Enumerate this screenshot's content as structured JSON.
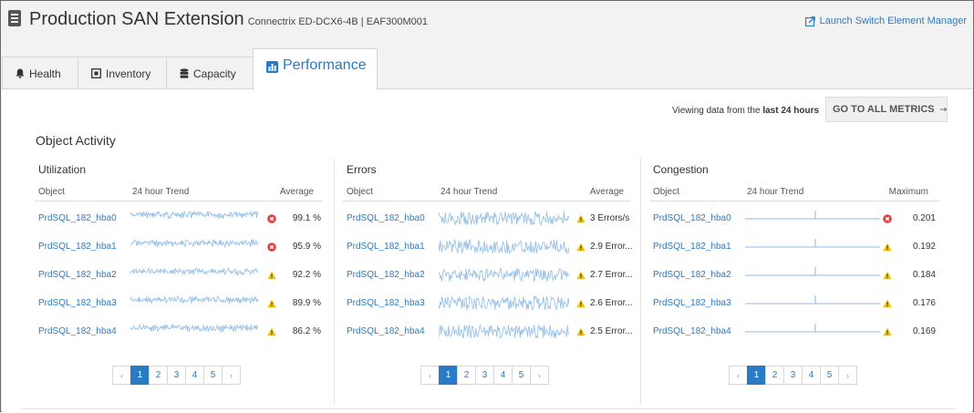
{
  "header": {
    "title": "Production SAN Extension",
    "subtitle": "Connectrix ED-DCX6-4B | EAF300M001",
    "launch_label": "Launch Switch Element Manager"
  },
  "tabs": [
    {
      "label": "Health",
      "icon": "bell-icon"
    },
    {
      "label": "Inventory",
      "icon": "inventory-icon"
    },
    {
      "label": "Capacity",
      "icon": "database-icon"
    },
    {
      "label": "Performance",
      "icon": "bar-chart-icon",
      "active": true
    }
  ],
  "toolbar": {
    "viewing_prefix": "Viewing data from the",
    "viewing_range": "last 24 hours",
    "metrics_button": "GO TO ALL METRICS"
  },
  "section_title": "Object Activity",
  "colors": {
    "accent": "#2a7bc4",
    "sparkline": "#8fbde6",
    "error": "#e0403a",
    "warning": "#f5c400"
  },
  "cards": [
    {
      "title": "Utilization",
      "columns": [
        "Object",
        "24 hour Trend",
        "Average"
      ],
      "trend_style": "dense-high",
      "rows": [
        {
          "object": "PrdSQL_182_hba0",
          "status": "error",
          "value": "99.1 %"
        },
        {
          "object": "PrdSQL_182_hba1",
          "status": "error",
          "value": "95.9 %"
        },
        {
          "object": "PrdSQL_182_hba2",
          "status": "warning",
          "value": "92.2 %"
        },
        {
          "object": "PrdSQL_182_hba3",
          "status": "warning",
          "value": "89.9 %"
        },
        {
          "object": "PrdSQL_182_hba4",
          "status": "warning",
          "value": "86.2 %"
        }
      ],
      "pagination": {
        "pages": [
          "1",
          "2",
          "3",
          "4",
          "5"
        ],
        "current": "1",
        "prev": "‹",
        "next": "›"
      }
    },
    {
      "title": "Errors",
      "columns": [
        "Object",
        "24 hour Trend",
        "Average"
      ],
      "trend_style": "noisy",
      "rows": [
        {
          "object": "PrdSQL_182_hba0",
          "status": "warning",
          "value": "3 Errors/s"
        },
        {
          "object": "PrdSQL_182_hba1",
          "status": "warning",
          "value": "2.9 Error..."
        },
        {
          "object": "PrdSQL_182_hba2",
          "status": "warning",
          "value": "2.7 Error..."
        },
        {
          "object": "PrdSQL_182_hba3",
          "status": "warning",
          "value": "2.6 Error..."
        },
        {
          "object": "PrdSQL_182_hba4",
          "status": "warning",
          "value": "2.5 Error..."
        }
      ],
      "pagination": {
        "pages": [
          "1",
          "2",
          "3",
          "4",
          "5"
        ],
        "current": "1",
        "prev": "‹",
        "next": "›"
      }
    },
    {
      "title": "Congestion",
      "columns": [
        "Object",
        "24 hour Trend",
        "Maximum"
      ],
      "trend_style": "flat-spike",
      "rows": [
        {
          "object": "PrdSQL_182_hba0",
          "status": "error",
          "value": "0.201"
        },
        {
          "object": "PrdSQL_182_hba1",
          "status": "warning",
          "value": "0.192"
        },
        {
          "object": "PrdSQL_182_hba2",
          "status": "warning",
          "value": "0.184"
        },
        {
          "object": "PrdSQL_182_hba3",
          "status": "warning",
          "value": "0.176"
        },
        {
          "object": "PrdSQL_182_hba4",
          "status": "warning",
          "value": "0.169"
        }
      ],
      "pagination": {
        "pages": [
          "1",
          "2",
          "3",
          "4",
          "5"
        ],
        "current": "1",
        "prev": "‹",
        "next": "›"
      }
    }
  ]
}
